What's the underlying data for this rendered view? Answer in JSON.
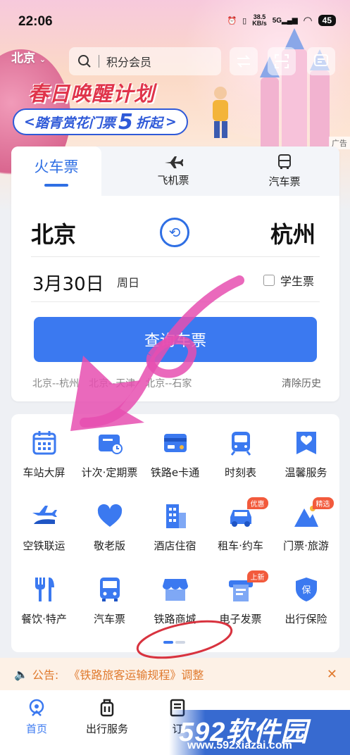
{
  "status_bar": {
    "time": "22:06",
    "speed_top": "38.5",
    "speed_bottom": "KB/s",
    "network": "5G",
    "battery": "45"
  },
  "header": {
    "city": "北京",
    "search_placeholder": "积分会员"
  },
  "banner": {
    "title": "春日唤醒计划",
    "subtitle_left": "踏青赏花门票",
    "subtitle_num": "5",
    "subtitle_right": "折起",
    "ad_label": "广告"
  },
  "booking": {
    "tabs": [
      {
        "label": "火车票",
        "icon": "train-icon"
      },
      {
        "label": "飞机票",
        "icon": "plane-icon"
      },
      {
        "label": "汽车票",
        "icon": "bus-icon"
      }
    ],
    "from": "北京",
    "to": "杭州",
    "date": "3月30日",
    "weekday": "周日",
    "student_label": "学生票",
    "query_button": "查询车票",
    "history": [
      "北京--杭州",
      "北京--天津",
      "北京--石家"
    ],
    "clear_history": "清除历史"
  },
  "services": [
    {
      "label": "车站大屏",
      "icon": "calendar-icon"
    },
    {
      "label": "计次·定期票",
      "icon": "ticket-clock-icon"
    },
    {
      "label": "铁路e卡通",
      "icon": "card-icon"
    },
    {
      "label": "时刻表",
      "icon": "train-front-icon"
    },
    {
      "label": "温馨服务",
      "icon": "heart-flag-icon"
    },
    {
      "label": "空铁联运",
      "icon": "plane-train-icon"
    },
    {
      "label": "敬老版",
      "icon": "heart-icon"
    },
    {
      "label": "酒店住宿",
      "icon": "hotel-icon"
    },
    {
      "label": "租车·约车",
      "icon": "car-icon",
      "tag": "优惠"
    },
    {
      "label": "门票·旅游",
      "icon": "mountain-icon",
      "tag": "精选"
    },
    {
      "label": "餐饮·特产",
      "icon": "utensils-icon"
    },
    {
      "label": "汽车票",
      "icon": "bus-icon"
    },
    {
      "label": "铁路商城",
      "icon": "shop-icon"
    },
    {
      "label": "电子发票",
      "icon": "invoice-icon",
      "tag": "上新"
    },
    {
      "label": "出行保险",
      "icon": "shield-icon"
    }
  ],
  "notice": {
    "prefix": "公告:",
    "text": "《铁路旅客运输规程》调整"
  },
  "bottom_nav": [
    {
      "label": "首页",
      "icon": "home-icon"
    },
    {
      "label": "出行服务",
      "icon": "luggage-icon"
    },
    {
      "label": "订",
      "icon": "order-icon"
    }
  ],
  "watermark": {
    "brand": "592软件园",
    "url": "www.592xiazai.com"
  },
  "colors": {
    "accent": "#2f6fe4",
    "button": "#3b79f0",
    "notice": "#e07a2e",
    "tag": "#f25a3c",
    "scribble": "#e64fb0"
  }
}
